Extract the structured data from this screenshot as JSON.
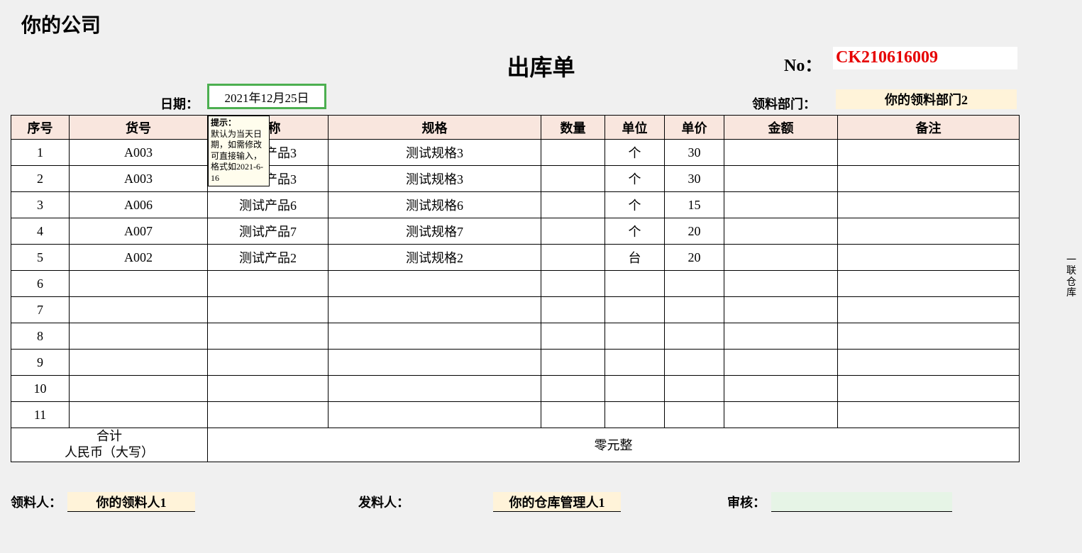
{
  "company_name": "你的公司",
  "title": "出库单",
  "no_label": "No：",
  "no_value": "CK210616009",
  "date_label": "日期：",
  "date_value": "2021年12月25日",
  "dept_label": "领料部门：",
  "dept_value": "你的领料部门2",
  "headers": {
    "seq": "序号",
    "code": "货号",
    "name": "名称",
    "spec": "规格",
    "qty": "数量",
    "unit": "单位",
    "price": "单价",
    "amount": "金额",
    "remark": "备注"
  },
  "rows": [
    {
      "seq": "1",
      "code": "A003",
      "name": "测试产品3",
      "spec": "测试规格3",
      "qty": "",
      "unit": "个",
      "price": "30",
      "amount": "",
      "remark": ""
    },
    {
      "seq": "2",
      "code": "A003",
      "name": "测试产品3",
      "spec": "测试规格3",
      "qty": "",
      "unit": "个",
      "price": "30",
      "amount": "",
      "remark": ""
    },
    {
      "seq": "3",
      "code": "A006",
      "name": "测试产品6",
      "spec": "测试规格6",
      "qty": "",
      "unit": "个",
      "price": "15",
      "amount": "",
      "remark": ""
    },
    {
      "seq": "4",
      "code": "A007",
      "name": "测试产品7",
      "spec": "测试规格7",
      "qty": "",
      "unit": "个",
      "price": "20",
      "amount": "",
      "remark": ""
    },
    {
      "seq": "5",
      "code": "A002",
      "name": "测试产品2",
      "spec": "测试规格2",
      "qty": "",
      "unit": "台",
      "price": "20",
      "amount": "",
      "remark": ""
    },
    {
      "seq": "6",
      "code": "",
      "name": "",
      "spec": "",
      "qty": "",
      "unit": "",
      "price": "",
      "amount": "",
      "remark": ""
    },
    {
      "seq": "7",
      "code": "",
      "name": "",
      "spec": "",
      "qty": "",
      "unit": "",
      "price": "",
      "amount": "",
      "remark": ""
    },
    {
      "seq": "8",
      "code": "",
      "name": "",
      "spec": "",
      "qty": "",
      "unit": "",
      "price": "",
      "amount": "",
      "remark": ""
    },
    {
      "seq": "9",
      "code": "",
      "name": "",
      "spec": "",
      "qty": "",
      "unit": "",
      "price": "",
      "amount": "",
      "remark": ""
    },
    {
      "seq": "10",
      "code": "",
      "name": "",
      "spec": "",
      "qty": "",
      "unit": "",
      "price": "",
      "amount": "",
      "remark": ""
    },
    {
      "seq": "11",
      "code": "",
      "name": "",
      "spec": "",
      "qty": "",
      "unit": "",
      "price": "",
      "amount": "",
      "remark": ""
    }
  ],
  "total_label_line1": "合计",
  "total_label_line2": "人民币（大写）",
  "total_value": "零元整",
  "footer": {
    "receiver_label": "领料人：",
    "receiver_value": "你的领料人1",
    "issuer_label": "发料人：",
    "issuer_value": "你的仓库管理人1",
    "auditor_label": "审核：",
    "auditor_value": ""
  },
  "tooltip": {
    "title": "提示：",
    "body": "默认为当天日期，如需修改可直接输入，格式如2021-6-16"
  },
  "side_text": "一联仓库"
}
